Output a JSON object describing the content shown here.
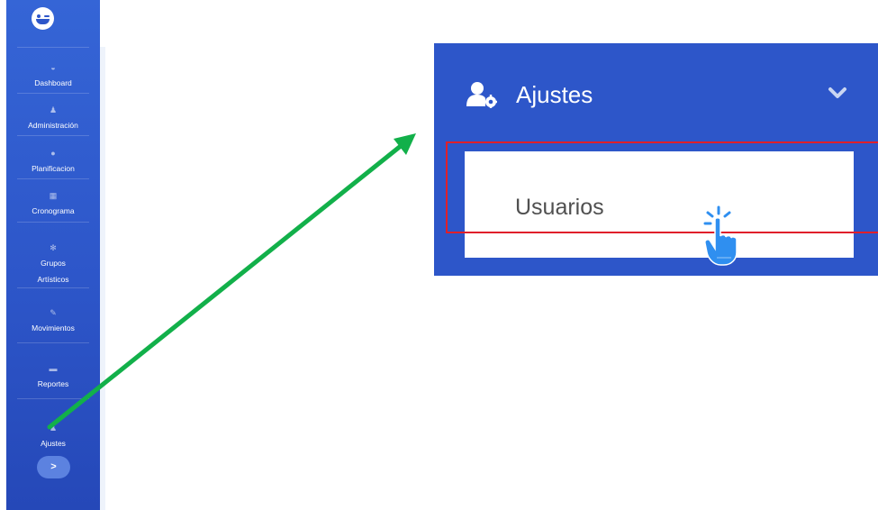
{
  "sidebar": {
    "logo": "smiley-logo-icon",
    "items": [
      {
        "label": "Dashboard",
        "icon": "gauge-icon"
      },
      {
        "label": "Administración",
        "icon": "users-cog-icon"
      },
      {
        "label": "Planificacion",
        "icon": "circle-icon"
      },
      {
        "label": "Cronograma",
        "icon": "calendar-icon"
      },
      {
        "label": "Grupos",
        "label2": "Artísticos",
        "icon": "gear-icon"
      },
      {
        "label": "Movimientos",
        "icon": "pencil-icon"
      },
      {
        "label": "Reportes",
        "icon": "book-icon"
      },
      {
        "label": "Ajustes",
        "icon": "users-cog-icon"
      }
    ],
    "expand_glyph": ">"
  },
  "zoom": {
    "title": "Ajustes",
    "sub_item": "Usuarios",
    "icon": "users-cog-icon",
    "chevron": "chevron-down-icon"
  },
  "colors": {
    "sidebar": "#2d56c9",
    "highlight": "#e01f2a",
    "arrow": "#12b04a"
  }
}
